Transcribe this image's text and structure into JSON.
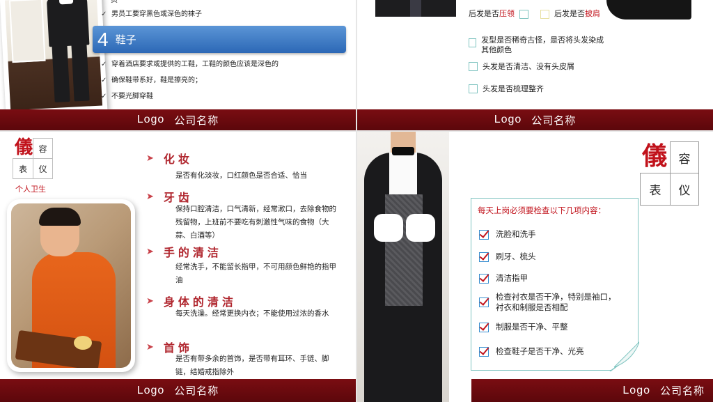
{
  "slide_tl": {
    "top_partial": "员",
    "line_socks": "男员工要穿黑色或深色的袜子",
    "bar_number": "4",
    "bar_title": "鞋子",
    "bullets": [
      "穿着酒店要求或提供的工鞋，工鞋的颜色应该是深色的",
      "确保鞋带系好，鞋是擦亮的；",
      "不要光脚穿鞋"
    ]
  },
  "slide_tr": {
    "left_label_prefix": "后发是否",
    "left_label_red": "压领",
    "right_label_prefix": "后发是否",
    "right_label_red": "披肩",
    "items": [
      "发型是否稀奇古怪，是否将头发染成其他颜色",
      "头发是否清洁、没有头皮屑",
      "头发是否梳理整齐"
    ]
  },
  "slide_bl": {
    "title_char": "儀",
    "cells": [
      "容",
      "表",
      "仪"
    ],
    "subtitle": "个人卫生",
    "sections": [
      {
        "title": "化妆",
        "body": "是否有化淡妆，口红颜色是否合适、恰当"
      },
      {
        "title": "牙齿",
        "body": "保持口腔清洁，口气清新，经常漱口，去除食物的残留物，上班前不要吃有刺激性气味的食物（大蒜、白酒等）"
      },
      {
        "title": "手的清洁",
        "body": "经常洗手，不能留长指甲，不可用颜色鲜艳的指甲油"
      },
      {
        "title": "身体的清洁",
        "body": "每天洗澡。经常更换内衣；不能使用过浓的香水"
      },
      {
        "title": "首饰",
        "body": "是否有带多余的首饰，是否带有耳环、手链、脚链，结婚戒指除外"
      }
    ]
  },
  "slide_br": {
    "title_char": "儀",
    "cells": [
      "容",
      "表",
      "仪"
    ],
    "checklist_head": "每天上岗必须要检查以下几项内容：",
    "checklist": [
      "洗脸和洗手",
      "刷牙、梳头",
      "清洁指甲",
      "检查衬衣是否干净，特别是袖口，衬衣和制服是否相配",
      "制服是否干净、平整",
      "检查鞋子是否干净、光亮"
    ]
  },
  "footer": {
    "logo": "Logo",
    "company": "公司名称"
  },
  "colors": {
    "footer": "#6e0b10",
    "accent_red": "#c1121b",
    "blue_bar": "#3a78c4",
    "teal_border": "#7fc4c0"
  }
}
